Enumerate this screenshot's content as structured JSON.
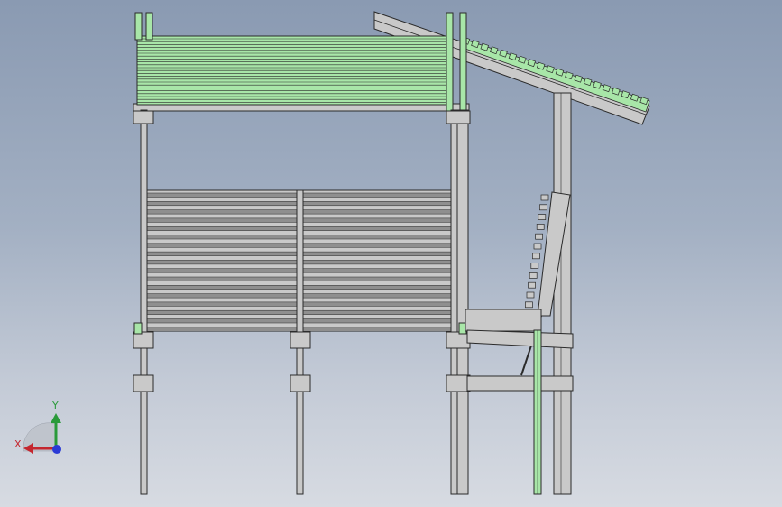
{
  "viewport": {
    "background_top": "#8a9ab2",
    "background_bottom": "#d7dbe2"
  },
  "model": {
    "view": "front",
    "part_color": "#c9c9c9",
    "edge_color": "#2a2a2a",
    "highlight_color": "#a8e6a8"
  },
  "triad": {
    "x_label": "X",
    "y_label": "Y",
    "x_color": "#c4262e",
    "y_color": "#2a9a3a",
    "z_color": "#2b3bd6"
  }
}
